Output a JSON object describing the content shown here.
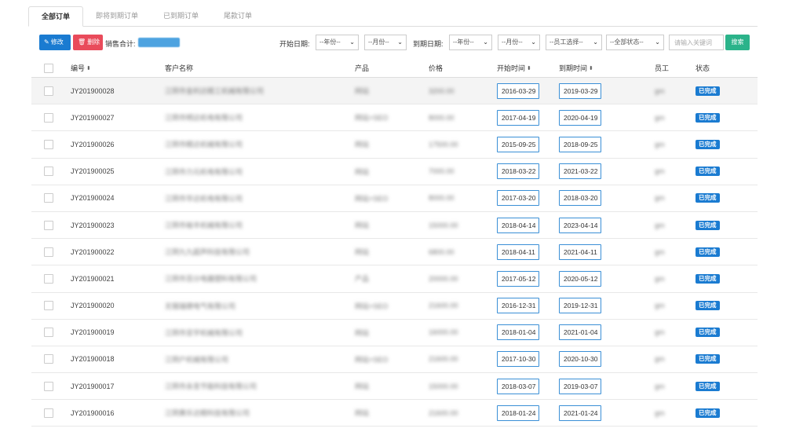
{
  "tabs": [
    {
      "label": "全部订单",
      "active": true
    },
    {
      "label": "即将到期订单",
      "active": false
    },
    {
      "label": "已到期订单",
      "active": false
    },
    {
      "label": "尾款订单",
      "active": false
    }
  ],
  "toolbar": {
    "edit_label": "修改",
    "delete_label": "删除",
    "sales_total_label": "销售合计:",
    "start_date_label": "开始日期:",
    "end_date_label": "到期日期:",
    "start_year": "--年份--",
    "start_month": "--月份--",
    "end_year": "--年份--",
    "end_month": "--月份--",
    "staff_select": "--员工选择--",
    "status_select": "--全部状态--",
    "search_placeholder": "请输入关键词",
    "search_label": "搜索"
  },
  "colors": {
    "primary": "#1a7bd1",
    "danger": "#e94b5b",
    "success": "#2bb38a"
  },
  "table": {
    "headers": {
      "number": "编号",
      "customer": "客户名称",
      "product": "产品",
      "price": "价格",
      "start": "开始时间",
      "end": "到期时间",
      "staff": "员工",
      "status": "状态"
    },
    "rows": [
      {
        "number": "JY201900028",
        "customer": "江阴市金利达精工机械有限公司",
        "product": "网站",
        "price": "3200.00",
        "start": "2016-03-29",
        "end": "2019-03-29",
        "staff": "gm",
        "status": "已完成"
      },
      {
        "number": "JY201900027",
        "customer": "江阴市明达机电有限公司",
        "product": "网站+SEO",
        "price": "8000.00",
        "start": "2017-04-19",
        "end": "2020-04-19",
        "staff": "gm",
        "status": "已完成"
      },
      {
        "number": "JY201900026",
        "customer": "江阴市精达机械有限公司",
        "product": "网站",
        "price": "17500.00",
        "start": "2015-09-25",
        "end": "2018-09-25",
        "staff": "gm",
        "status": "已完成"
      },
      {
        "number": "JY201900025",
        "customer": "江阴市力元机电有限公司",
        "product": "网站",
        "price": "7000.00",
        "start": "2018-03-22",
        "end": "2021-03-22",
        "staff": "gm",
        "status": "已完成"
      },
      {
        "number": "JY201900024",
        "customer": "江阴市华达机电有限公司",
        "product": "网站+SEO",
        "price": "8000.00",
        "start": "2017-03-20",
        "end": "2018-03-20",
        "staff": "gm",
        "status": "已完成"
      },
      {
        "number": "JY201900023",
        "customer": "江阴市裕丰机械有限公司",
        "product": "网站",
        "price": "15000.00",
        "start": "2018-04-14",
        "end": "2023-04-14",
        "staff": "gm",
        "status": "已完成"
      },
      {
        "number": "JY201900022",
        "customer": "江阴九九超声科技有限公司",
        "product": "网站",
        "price": "6800.00",
        "start": "2018-04-11",
        "end": "2021-04-11",
        "staff": "gm",
        "status": "已完成"
      },
      {
        "number": "JY201900021",
        "customer": "江阴市百分电器塑料有限公司",
        "product": "产品",
        "price": "20000.00",
        "start": "2017-05-12",
        "end": "2020-05-12",
        "staff": "gm",
        "status": "已完成"
      },
      {
        "number": "JY201900020",
        "customer": "无锡瑞德电气有限公司",
        "product": "网站+SEO",
        "price": "21600.00",
        "start": "2016-12-31",
        "end": "2019-12-31",
        "staff": "gm",
        "status": "已完成"
      },
      {
        "number": "JY201900019",
        "customer": "江阴市亚宇机械有限公司",
        "product": "网站",
        "price": "16000.00",
        "start": "2018-01-04",
        "end": "2021-01-04",
        "staff": "gm",
        "status": "已完成"
      },
      {
        "number": "JY201900018",
        "customer": "江阴户机械有限公司",
        "product": "网站+SEO",
        "price": "21600.00",
        "start": "2017-10-30",
        "end": "2020-10-30",
        "staff": "gm",
        "status": "已完成"
      },
      {
        "number": "JY201900017",
        "customer": "江阴市永圣节能科技有限公司",
        "product": "网站",
        "price": "15000.00",
        "start": "2018-03-07",
        "end": "2019-03-07",
        "staff": "gm",
        "status": "已完成"
      },
      {
        "number": "JY201900016",
        "customer": "江阴黄乐达精科技有限公司",
        "product": "网站",
        "price": "21600.00",
        "start": "2018-01-24",
        "end": "2021-01-24",
        "staff": "gm",
        "status": "已完成"
      }
    ]
  }
}
